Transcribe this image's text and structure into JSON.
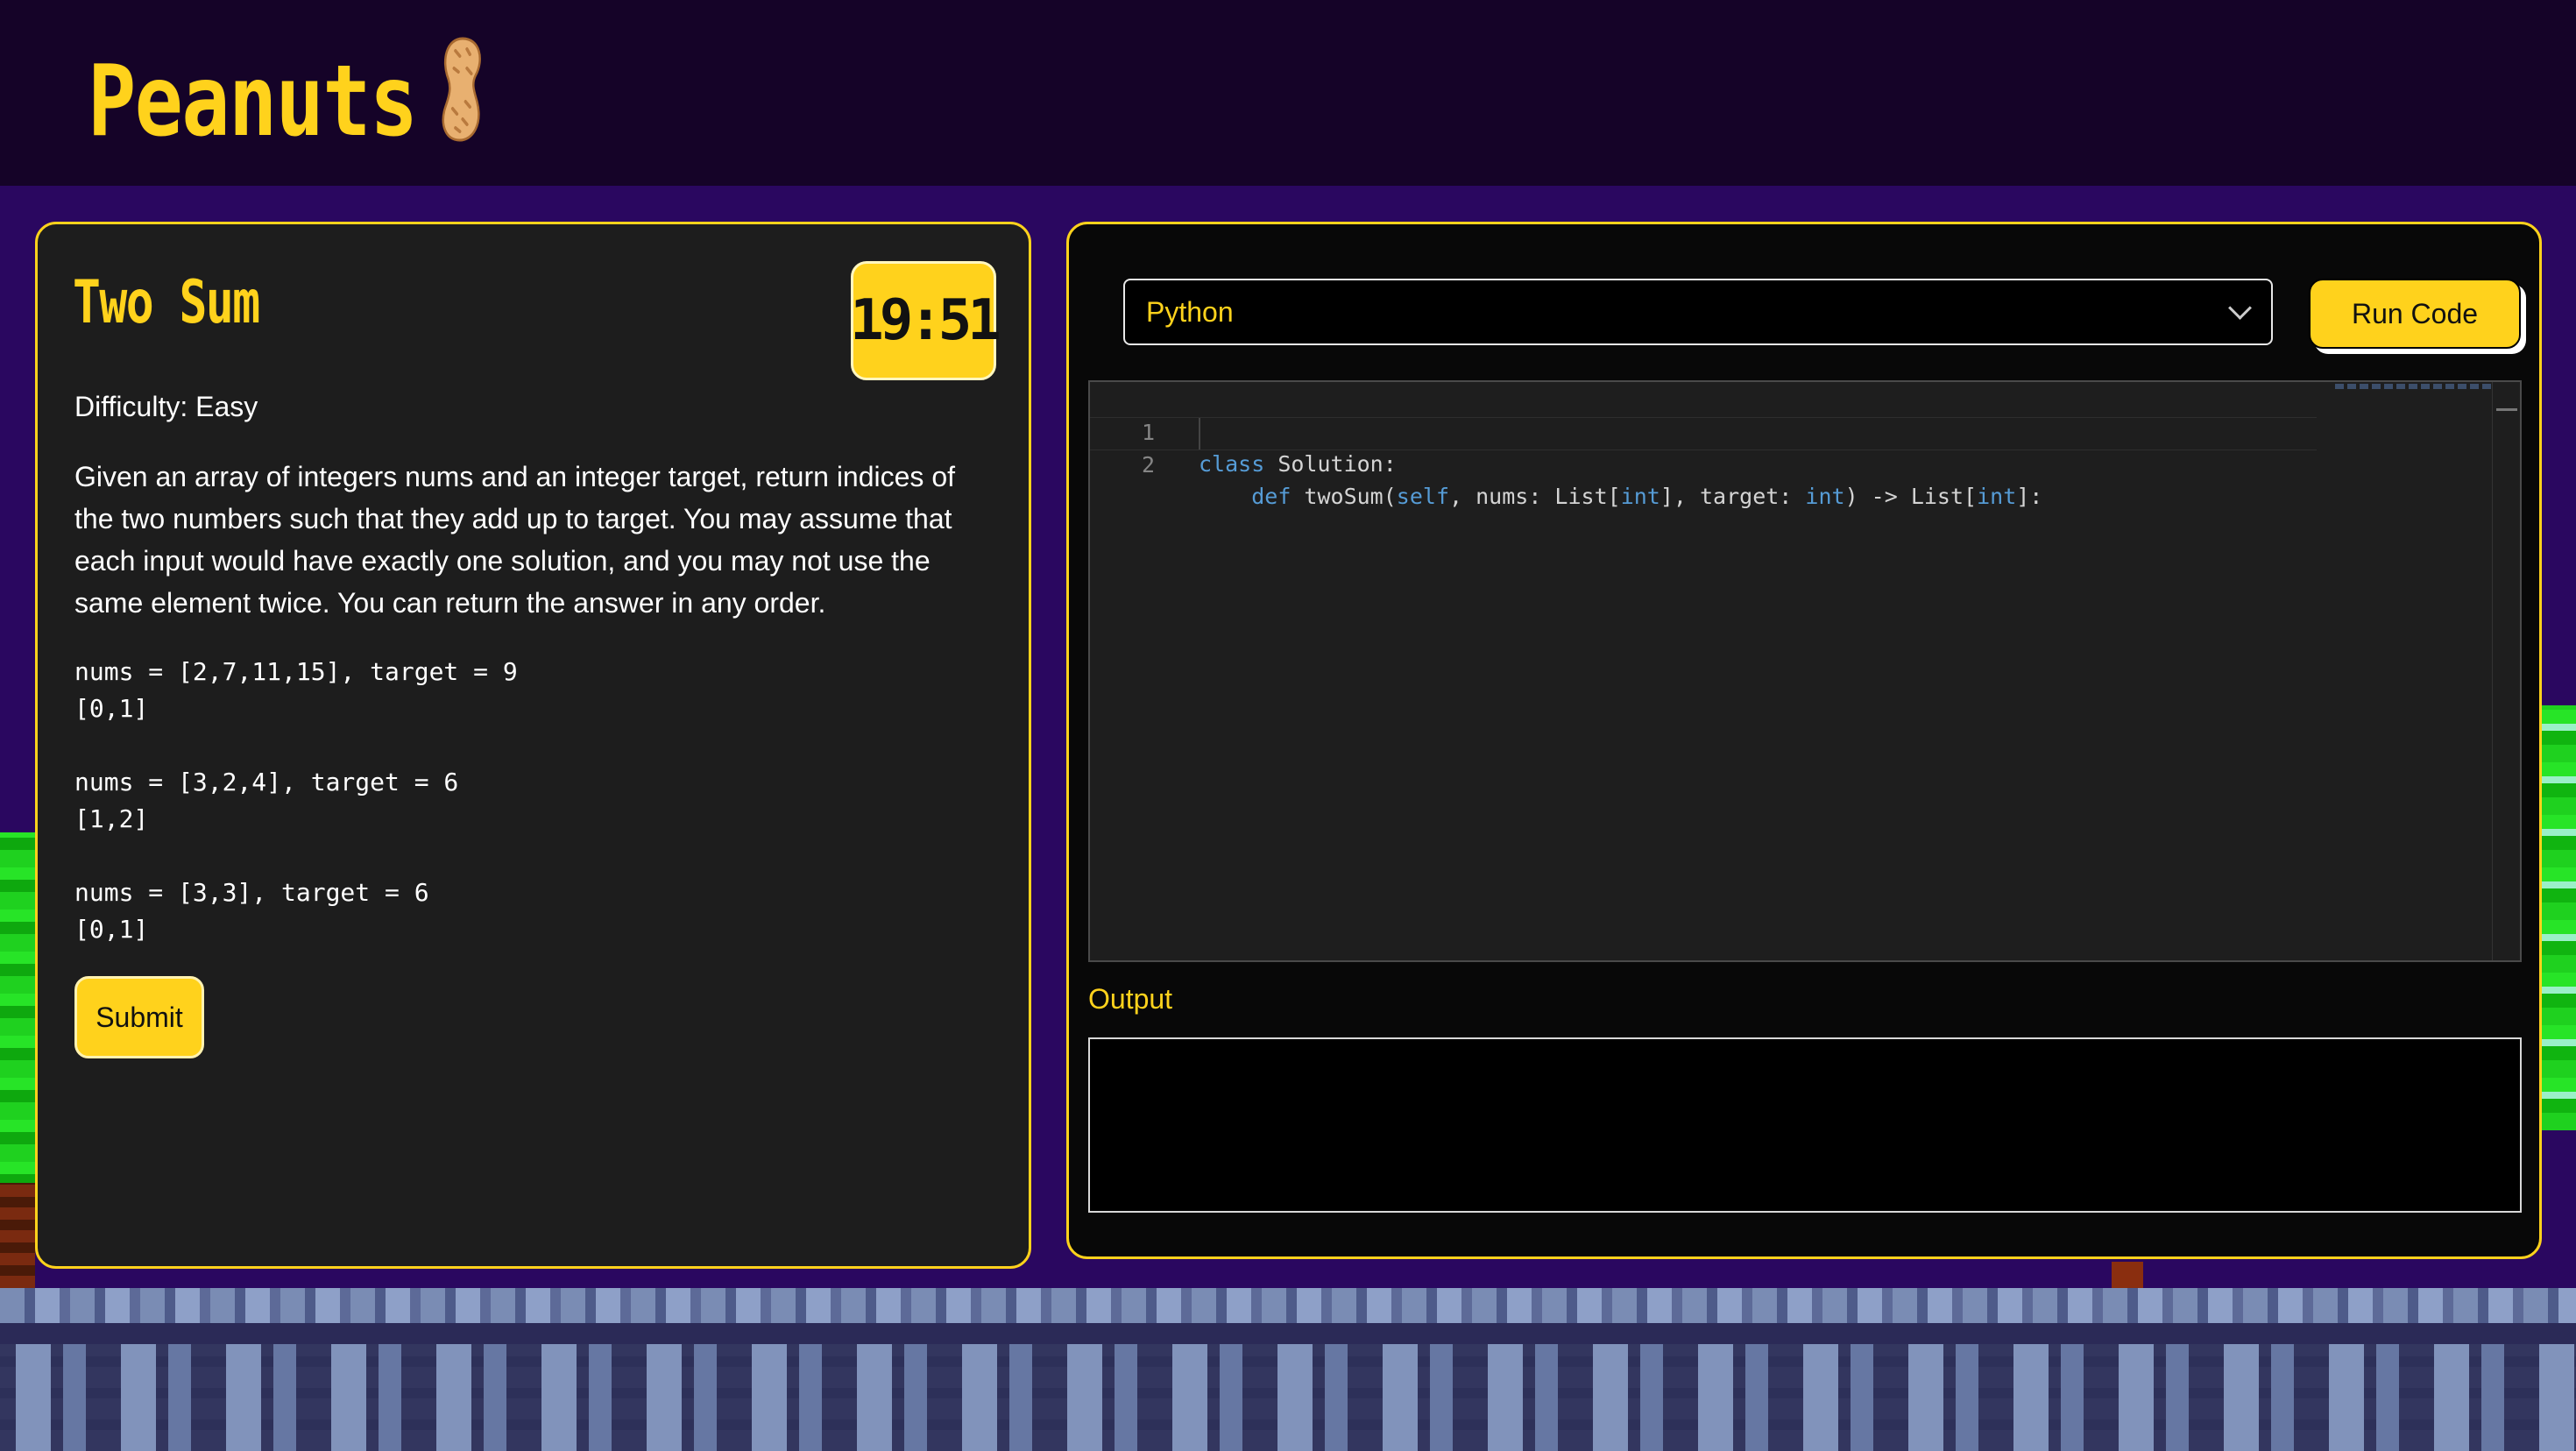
{
  "app": {
    "brand": "Peanuts",
    "brand_icon": "peanut-icon"
  },
  "problem": {
    "title": "Two Sum",
    "timer": "19:51",
    "difficulty": "Difficulty: Easy",
    "description": "Given an array of integers nums and an integer target, return indices of the two numbers such that they add up to target. You may assume that each input would have exactly one solution, and you may not use the same element twice. You can return the answer in any order.",
    "examples": [
      {
        "input": "nums = [2,7,11,15], target = 9",
        "output": "[0,1]"
      },
      {
        "input": "nums = [3,2,4], target = 6",
        "output": "[1,2]"
      },
      {
        "input": "nums = [3,3], target = 6",
        "output": "[0,1]"
      }
    ],
    "submit_label": "Submit"
  },
  "editor": {
    "language": "Python",
    "run_label": "Run Code",
    "code_lines": [
      {
        "number": "1",
        "kw": "class",
        "rest": " Solution:"
      },
      {
        "number": "2",
        "text": "    def twoSum(self, nums: List[int], target: int) -> List[int]:"
      }
    ],
    "output_label": "Output",
    "output_value": ""
  },
  "colors": {
    "accent": "#ffd21c",
    "header_bg": "#150328",
    "page_bg": "#2a0760",
    "panel_bg": "#1d1d1d",
    "keyword": "#569cd6"
  }
}
